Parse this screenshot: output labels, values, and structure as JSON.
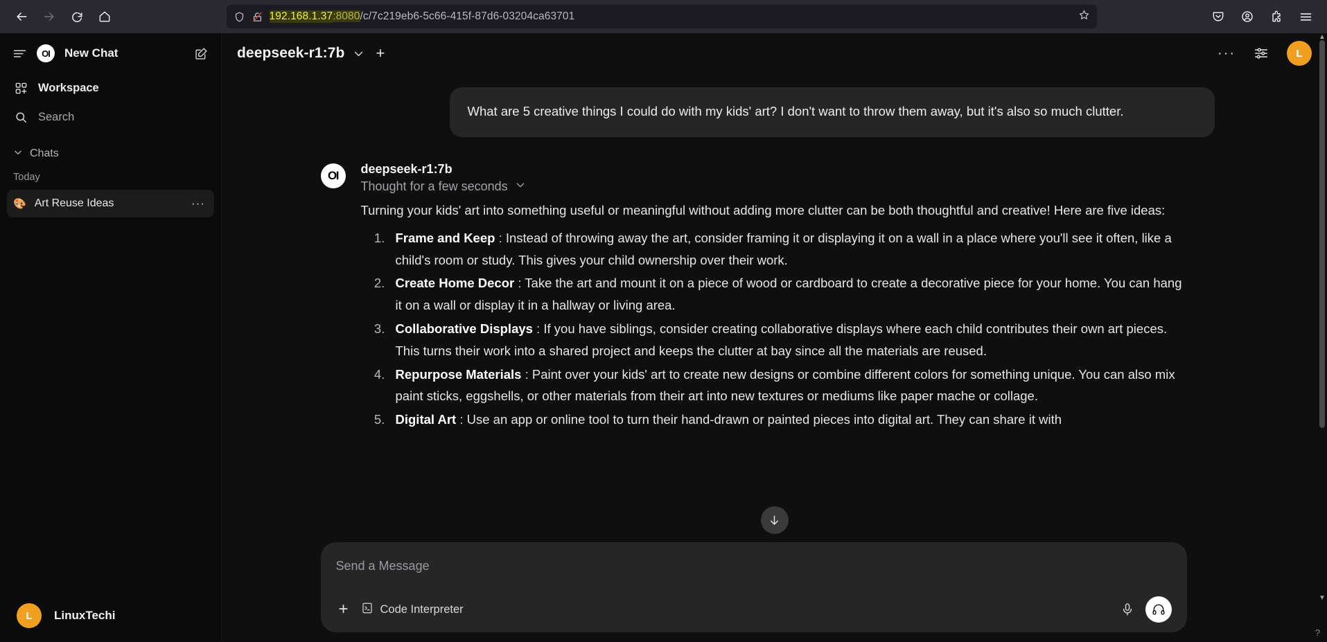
{
  "browser": {
    "nav": {
      "back": "back-arrow",
      "forward": "forward-arrow",
      "reload": "reload",
      "home": "home"
    },
    "url": {
      "host": "192.168.1.37",
      "port": ":8080",
      "path": "/c/7c219eb6-5c66-415f-87d6-03204ca63701",
      "full": "192.168.1.37:8080/c/7c219eb6-5c66-415f-87d6-03204ca63701"
    },
    "icons": {
      "shield": "shield-icon",
      "lock_broken": "insecure-connection-icon",
      "bookmark": "star-icon",
      "pocket": "pocket-icon",
      "account": "account-icon",
      "extensions": "extensions-icon",
      "menu": "app-menu-icon"
    },
    "colors": {
      "toolbar_bg": "#2b2a33",
      "urlbar_bg": "#1c1b22",
      "host_highlight_bg": "#3a3a10",
      "host_text": "#f1f136"
    }
  },
  "sidebar": {
    "new_chat_label": "New Chat",
    "logo_text": "OI",
    "rows": [
      {
        "label": "Workspace",
        "icon": "workspace-icon"
      },
      {
        "label": "Search",
        "icon": "search-icon"
      }
    ],
    "chats_header": "Chats",
    "group_label": "Today",
    "chat_items": [
      {
        "emoji": "🎨",
        "title": "Art Reuse Ideas",
        "menu": "···",
        "selected": true
      }
    ],
    "user": {
      "initial": "L",
      "name": "LinuxTechi",
      "avatar_color": "#f0a020"
    }
  },
  "main_header": {
    "model_name": "deepseek-r1:7b",
    "chevron": "chevron-down-icon",
    "new_tab": "+",
    "more": "···",
    "controls_icon": "sliders-icon",
    "avatar_initial": "L"
  },
  "conversation": {
    "user_message": "What are 5 creative things I could do with my kids' art? I don't want to throw them away, but it's also so much clutter.",
    "assistant": {
      "logo_text": "OI",
      "name": "deepseek-r1:7b",
      "thought_label": "Thought for a few seconds",
      "intro": "Turning your kids' art into something useful or meaningful without adding more clutter can be both thoughtful and creative! Here are five ideas:",
      "ideas": [
        {
          "title": "Frame and Keep",
          "sep": ":",
          "body": "Instead of throwing away the art, consider framing it or displaying it on a wall in a place where you'll see it often, like a child's room or study. This gives your child ownership over their work."
        },
        {
          "title": "Create Home Decor",
          "sep": ":",
          "body": "Take the art and mount it on a piece of wood or cardboard to create a decorative piece for your home. You can hang it on a wall or display it in a hallway or living area."
        },
        {
          "title": "Collaborative Displays",
          "sep": ":",
          "body": "If you have siblings, consider creating collaborative displays where each child contributes their own art pieces. This turns their work into a shared project and keeps the clutter at bay since all the materials are reused."
        },
        {
          "title": "Repurpose Materials",
          "sep": ":",
          "body": "Paint over your kids' art to create new designs or combine different colors for something unique. You can also mix paint sticks, eggshells, or other materials from their art into new textures or mediums like paper mache or collage."
        },
        {
          "title": "Digital Art",
          "sep": ":",
          "body": "Use an app or online tool to turn their hand-drawn or painted pieces into digital art. They can share it with"
        }
      ]
    },
    "scroll_down_icon": "arrow-down-icon"
  },
  "composer": {
    "placeholder": "Send a Message",
    "add_label": "+",
    "tool_label": "Code Interpreter",
    "mic_icon": "microphone-icon",
    "call_icon": "headphones-icon"
  },
  "misc": {
    "help": "?"
  }
}
